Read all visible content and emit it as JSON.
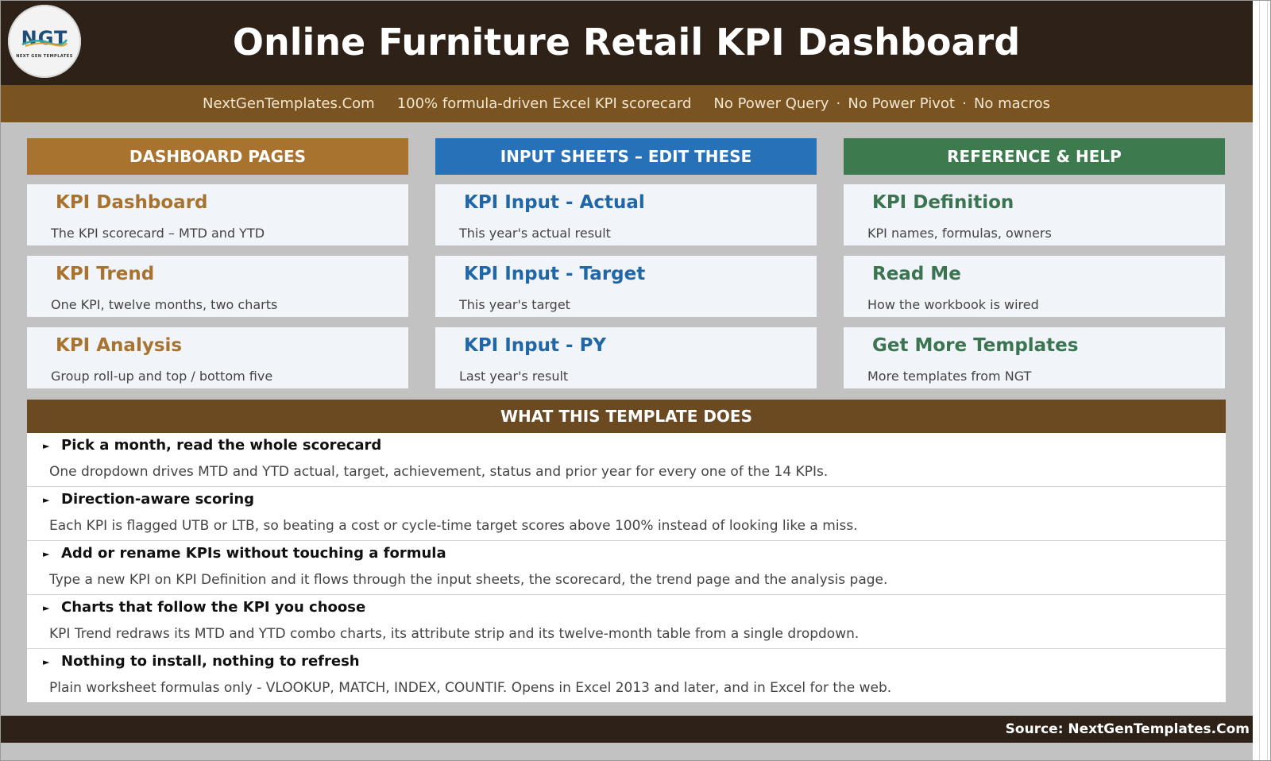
{
  "header": {
    "logo_text": "NGT",
    "logo_subtext": "NEXT GEN TEMPLATES",
    "title": "Online Furniture Retail KPI Dashboard"
  },
  "subbar": {
    "site": "NextGenTemplates.Com",
    "tagline": "100% formula-driven Excel KPI scorecard",
    "note1": "No Power Query",
    "note2": "No Power Pivot",
    "note3": "No macros",
    "separator": "·"
  },
  "columns": [
    {
      "heading": "DASHBOARD PAGES",
      "color": "#a8732e",
      "title_color": "#a8732e",
      "cards": [
        {
          "title": "KPI Dashboard",
          "subtitle": "The KPI scorecard – MTD and YTD"
        },
        {
          "title": "KPI Trend",
          "subtitle": "One KPI, twelve months, two charts"
        },
        {
          "title": "KPI Analysis",
          "subtitle": "Group roll-up and top / bottom five"
        }
      ]
    },
    {
      "heading": "INPUT SHEETS – EDIT THESE",
      "color": "#2671b8",
      "title_color": "#2167a8",
      "cards": [
        {
          "title": "KPI Input - Actual",
          "subtitle": "This year's actual result"
        },
        {
          "title": "KPI Input - Target",
          "subtitle": "This year's target"
        },
        {
          "title": "KPI Input - PY",
          "subtitle": "Last year's result"
        }
      ]
    },
    {
      "heading": "REFERENCE & HELP",
      "color": "#3d7a4e",
      "title_color": "#3a7450",
      "cards": [
        {
          "title": "KPI Definition",
          "subtitle": "KPI names, formulas, owners"
        },
        {
          "title": "Read Me",
          "subtitle": "How the workbook is wired"
        },
        {
          "title": "Get More Templates",
          "subtitle": "More templates from NGT"
        }
      ]
    }
  ],
  "features": {
    "heading": "WHAT THIS TEMPLATE DOES",
    "bullet": "►",
    "items": [
      {
        "title": "Pick a month, read the whole scorecard",
        "desc": "One dropdown drives MTD and YTD actual, target, achievement, status and prior year for every one of the 14 KPIs."
      },
      {
        "title": "Direction-aware scoring",
        "desc": "Each KPI is flagged UTB or LTB, so beating a cost or cycle-time target scores above 100% instead of looking like a miss."
      },
      {
        "title": "Add or rename KPIs without touching a formula",
        "desc": "Type a new KPI on KPI Definition and it flows through the input sheets, the scorecard, the trend page and the analysis page."
      },
      {
        "title": "Charts that follow the KPI you choose",
        "desc": "KPI Trend redraws its MTD and YTD combo charts, its attribute strip and its twelve-month table from a single dropdown."
      },
      {
        "title": "Nothing to install, nothing to refresh",
        "desc": "Plain worksheet formulas only - VLOOKUP, MATCH, INDEX, COUNTIF. Opens in Excel 2013 and later, and in Excel for the web."
      }
    ]
  },
  "footer": {
    "source": "Source: NextGenTemplates.Com"
  }
}
